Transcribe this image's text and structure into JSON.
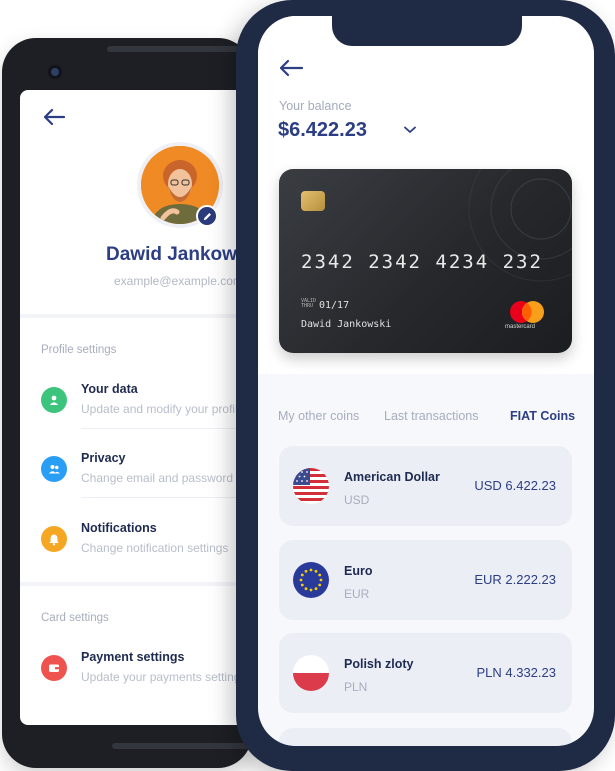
{
  "profile": {
    "name": "Dawid Jankowski",
    "email": "example@example.com",
    "profile_settings_title": "Profile settings",
    "items": [
      {
        "title": "Your data",
        "desc": "Update and modify your profile",
        "icon": "user-icon",
        "color": "#3cc47c"
      },
      {
        "title": "Privacy",
        "desc": "Change email and password",
        "icon": "people-icon",
        "color": "#2a9df4"
      },
      {
        "title": "Notifications",
        "desc": "Change notification settings",
        "icon": "bell-icon",
        "color": "#f5a623"
      }
    ],
    "card_settings_title": "Card settings",
    "card_items": [
      {
        "title": "Payment settings",
        "desc": "Update your payments settings",
        "icon": "wallet-icon",
        "color": "#ef5350"
      }
    ]
  },
  "wallet": {
    "balance_label": "Your balance",
    "balance": "$6.422.23",
    "card": {
      "number": "2342 2342 4234 232",
      "valid_label": "VALID THRU",
      "expiry": "01/17",
      "holder": "Dawid Jankowski",
      "brand": "mastercard"
    },
    "tabs": [
      {
        "label": "My other coins",
        "active": false
      },
      {
        "label": "Last transactions",
        "active": false
      },
      {
        "label": "FIAT Coins",
        "active": true
      }
    ],
    "coins": [
      {
        "name": "American Dollar",
        "code": "USD",
        "amount": "USD 6.422.23",
        "flag": "usa-flag-icon"
      },
      {
        "name": "Euro",
        "code": "EUR",
        "amount": "EUR 2.222.23",
        "flag": "eu-flag-icon"
      },
      {
        "name": "Polish zloty",
        "code": "PLN",
        "amount": "PLN 4.332.23",
        "flag": "poland-flag-icon"
      }
    ]
  },
  "colors": {
    "accent": "#2c3e84",
    "phone_frame_front": "#1f2b45",
    "phone_frame_back": "#1d1f24"
  }
}
